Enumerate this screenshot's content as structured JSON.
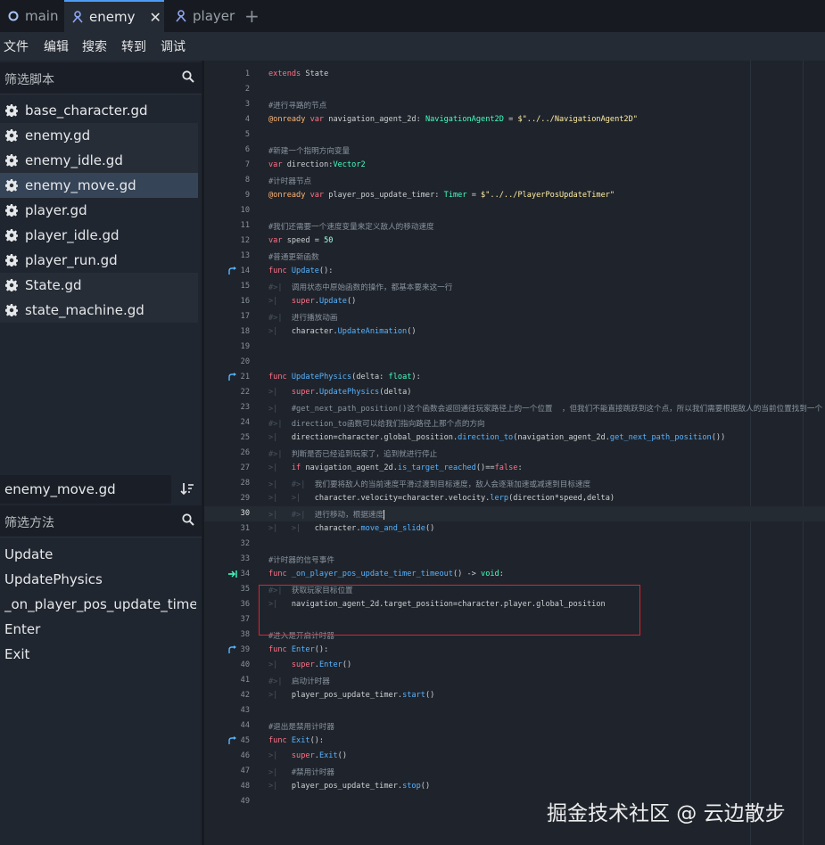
{
  "tabs": [
    {
      "label": "main",
      "icon": "circle-icon"
    },
    {
      "label": "enemy",
      "icon": "scene-icon",
      "active": true
    },
    {
      "label": "player",
      "icon": "scene-icon"
    }
  ],
  "tab_close": "✕",
  "tab_add": "+",
  "menu": [
    "文件",
    "编辑",
    "搜索",
    "转到",
    "调试"
  ],
  "script_filter_placeholder": "筛选脚本",
  "scripts": [
    "base_character.gd",
    "enemy.gd",
    "enemy_idle.gd",
    "enemy_move.gd",
    "player.gd",
    "player_idle.gd",
    "player_run.gd",
    "State.gd",
    "state_machine.gd"
  ],
  "selected_script": "enemy_move.gd",
  "current_script_label": "enemy_move.gd",
  "method_filter_placeholder": "筛选方法",
  "methods": [
    "Update",
    "UpdatePhysics",
    "_on_player_pos_update_timer_...",
    "Enter",
    "Exit"
  ],
  "line_numbers": [
    "1",
    "2",
    "3",
    "4",
    "5",
    "6",
    "7",
    "8",
    "9",
    "10",
    "11",
    "12",
    "13",
    "14",
    "15",
    "16",
    "17",
    "18",
    "19",
    "20",
    "21",
    "22",
    "23",
    "24",
    "25",
    "26",
    "27",
    "28",
    "29",
    "30",
    "31",
    "32",
    "33",
    "34",
    "35",
    "36",
    "37",
    "38",
    "39",
    "40",
    "41",
    "42",
    "43",
    "44",
    "45",
    "46",
    "47",
    "48",
    "49"
  ],
  "code": {
    "l1a": "extends",
    "l1b": " State",
    "l3": "#进行寻路的节点",
    "l4a": "@onready",
    "l4b": " var",
    "l4c": " navigation_agent_2d: ",
    "l4d": "NavigationAgent2D",
    "l4e": " = ",
    "l4f": "$\"../../NavigationAgent2D\"",
    "l6": "#新建一个指明方向变量",
    "l7a": "var",
    "l7b": " direction:",
    "l7c": "Vector2",
    "l8": "#计时器节点",
    "l9a": "@onready",
    "l9b": " var",
    "l9c": " player_pos_update_timer: ",
    "l9d": "Timer",
    "l9e": " = ",
    "l9f": "$\"../../PlayerPosUpdateTimer\"",
    "l11": "#我们还需要一个速度变量来定义敌人的移动速度",
    "l12a": "var",
    "l12b": " speed = ",
    "l12c": "50",
    "l13": "#普通更新函数",
    "l14a": "func",
    "l14b": " Update",
    "l14c": "():",
    "l15": "调用状态中原始函数的操作，都基本要来这一行",
    "l16a": "super",
    "l16b": ".",
    "l16c": "Update",
    "l16d": "()",
    "l17": "进行播放动画",
    "l18a": "character.",
    "l18b": "UpdateAnimation",
    "l18c": "()",
    "l21a": "func",
    "l21b": " UpdatePhysics",
    "l21c": "(delta: ",
    "l21d": "float",
    "l21e": "):",
    "l22a": "super",
    "l22b": ".",
    "l22c": "UpdatePhysics",
    "l22d": "(delta)",
    "l23": "#get_next_path_position()这个函数会返回通往玩家路径上的一个位置  ，但我们不能直接跳跃到这个点，所以我们需要根据敌人的当前位置找到一个",
    "l24": "direction_to函数可以给我们指向路径上那个点的方向",
    "l25a": "direction=character.global_position.",
    "l25b": "direction_to",
    "l25c": "(navigation_agent_2d.",
    "l25d": "get_next_path_position",
    "l25e": "())",
    "l26": "判断是否已经追到玩家了，追到就进行停止",
    "l27a": "if",
    "l27b": " navigation_agent_2d.",
    "l27c": "is_target_reached",
    "l27d": "()==",
    "l27e": "false",
    "l27f": ":",
    "l28": "我们要将敌人的当前速度平滑过渡到目标速度，敌人会逐渐加速或减速到目标速度",
    "l29a": "character.velocity=character.velocity.",
    "l29b": "lerp",
    "l29c": "(direction*speed,delta)",
    "l30": "进行移动，根据速度",
    "l31a": "character.",
    "l31b": "move_and_slide",
    "l31c": "()",
    "l33": "#计时器的信号事件",
    "l34a": "func",
    "l34b": " _on_player_pos_update_timer_timeout",
    "l34c": "() -> ",
    "l34d": "void",
    "l34e": ":",
    "l35": "获取玩家目标位置",
    "l36": "navigation_agent_2d.target_position=character.player.global_position",
    "l38": "#进入是开启计时器",
    "l39a": "func",
    "l39b": " Enter",
    "l39c": "():",
    "l40a": "super",
    "l40b": ".",
    "l40c": "Enter",
    "l40d": "()",
    "l41": "启动计时器",
    "l42a": "player_pos_update_timer.",
    "l42b": "start",
    "l42c": "()",
    "l44": "#退出是禁用计时器",
    "l45a": "func",
    "l45b": " Exit",
    "l45c": "():",
    "l46a": "super",
    "l46b": ".",
    "l46c": "Exit",
    "l46d": "()",
    "l47": "#禁用计时器",
    "l48a": "player_pos_update_timer.",
    "l48b": "stop",
    "l48c": "()"
  },
  "watermark": "掘金技术社区 @ 云边散步",
  "colors": {
    "accent": "#4d9cf5",
    "highlight_box": "#e0222e",
    "keyword": "#ff7085",
    "type": "#42ffc2",
    "function": "#57b3ff",
    "string": "#ffeda1",
    "comment": "#8a939e"
  }
}
